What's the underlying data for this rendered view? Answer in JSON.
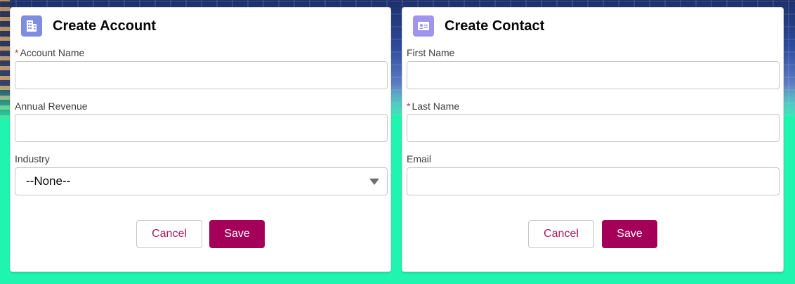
{
  "account_form": {
    "title": "Create Account",
    "icon": "building-icon",
    "icon_color": "#7f8de1",
    "fields": {
      "account_name": {
        "label": "Account Name",
        "required": true,
        "value": ""
      },
      "annual_revenue": {
        "label": "Annual Revenue",
        "required": false,
        "value": ""
      },
      "industry": {
        "label": "Industry",
        "selected": "--None--"
      }
    },
    "cancel_label": "Cancel",
    "save_label": "Save"
  },
  "contact_form": {
    "title": "Create Contact",
    "icon": "contact-card-icon",
    "icon_color": "#a094ed",
    "fields": {
      "first_name": {
        "label": "First Name",
        "required": false,
        "value": ""
      },
      "last_name": {
        "label": "Last Name",
        "required": true,
        "value": ""
      },
      "email": {
        "label": "Email",
        "required": false,
        "value": ""
      }
    },
    "cancel_label": "Cancel",
    "save_label": "Save"
  },
  "required_marker": "*",
  "colors": {
    "brand_button": "#a4005a",
    "required": "#c23934",
    "background_bottom": "#1ff5ae"
  }
}
